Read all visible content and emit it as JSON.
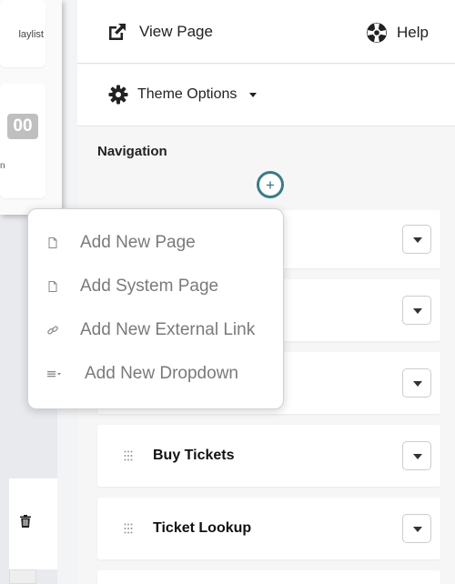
{
  "left": {
    "playlist_text": "laylist",
    "counter": "00",
    "counter_caption": "n"
  },
  "header": {
    "view_page": "View Page",
    "help": "Help"
  },
  "theme": {
    "label": "Theme Options"
  },
  "navigation": {
    "heading": "Navigation",
    "add_symbol": "+",
    "rows": [
      {
        "label": ""
      },
      {
        "label": ""
      },
      {
        "label": ""
      },
      {
        "label": "Buy Tickets"
      },
      {
        "label": "Ticket Lookup"
      }
    ]
  },
  "menu": {
    "items": [
      {
        "label": "Add New Page",
        "icon": "page-icon"
      },
      {
        "label": "Add System Page",
        "icon": "page-icon"
      },
      {
        "label": "Add New External Link",
        "icon": "link-icon"
      },
      {
        "label": "Add New Dropdown",
        "icon": "dropdown-list-icon"
      }
    ]
  },
  "colors": {
    "accent": "#3a7c86",
    "menu_text": "#7a7a7a"
  }
}
